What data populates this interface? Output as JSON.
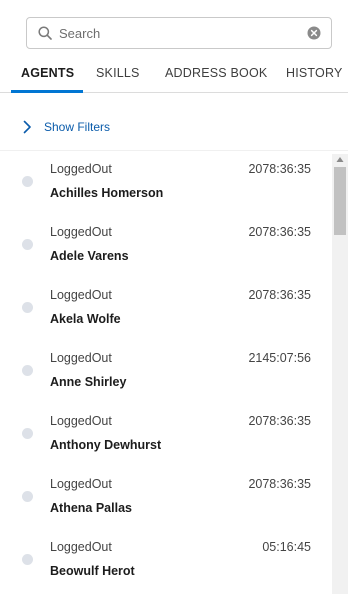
{
  "search": {
    "placeholder": "Search",
    "value": ""
  },
  "tabs": [
    {
      "label": "AGENTS",
      "active": true
    },
    {
      "label": "SKILLS",
      "active": false
    },
    {
      "label": "ADDRESS BOOK",
      "active": false
    },
    {
      "label": "HISTORY",
      "active": false
    }
  ],
  "filters": {
    "label": "Show Filters"
  },
  "agents": [
    {
      "status": "LoggedOut",
      "name": "Achilles Homerson",
      "time": "2078:36:35"
    },
    {
      "status": "LoggedOut",
      "name": "Adele Varens",
      "time": "2078:36:35"
    },
    {
      "status": "LoggedOut",
      "name": "Akela Wolfe",
      "time": "2078:36:35"
    },
    {
      "status": "LoggedOut",
      "name": "Anne Shirley",
      "time": "2145:07:56"
    },
    {
      "status": "LoggedOut",
      "name": "Anthony Dewhurst",
      "time": "2078:36:35"
    },
    {
      "status": "LoggedOut",
      "name": "Athena Pallas",
      "time": "2078:36:35"
    },
    {
      "status": "LoggedOut",
      "name": "Beowulf Herot",
      "time": "05:16:45"
    }
  ],
  "colors": {
    "accent": "#0176d3",
    "link": "#0b5cab",
    "status_dot_logged_out": "#dde1e8"
  },
  "icons": {
    "search": "search-icon",
    "clear": "clear-icon",
    "filters_toggle": "chevron-right-icon",
    "scroll_up": "scroll-up-arrow-icon"
  }
}
